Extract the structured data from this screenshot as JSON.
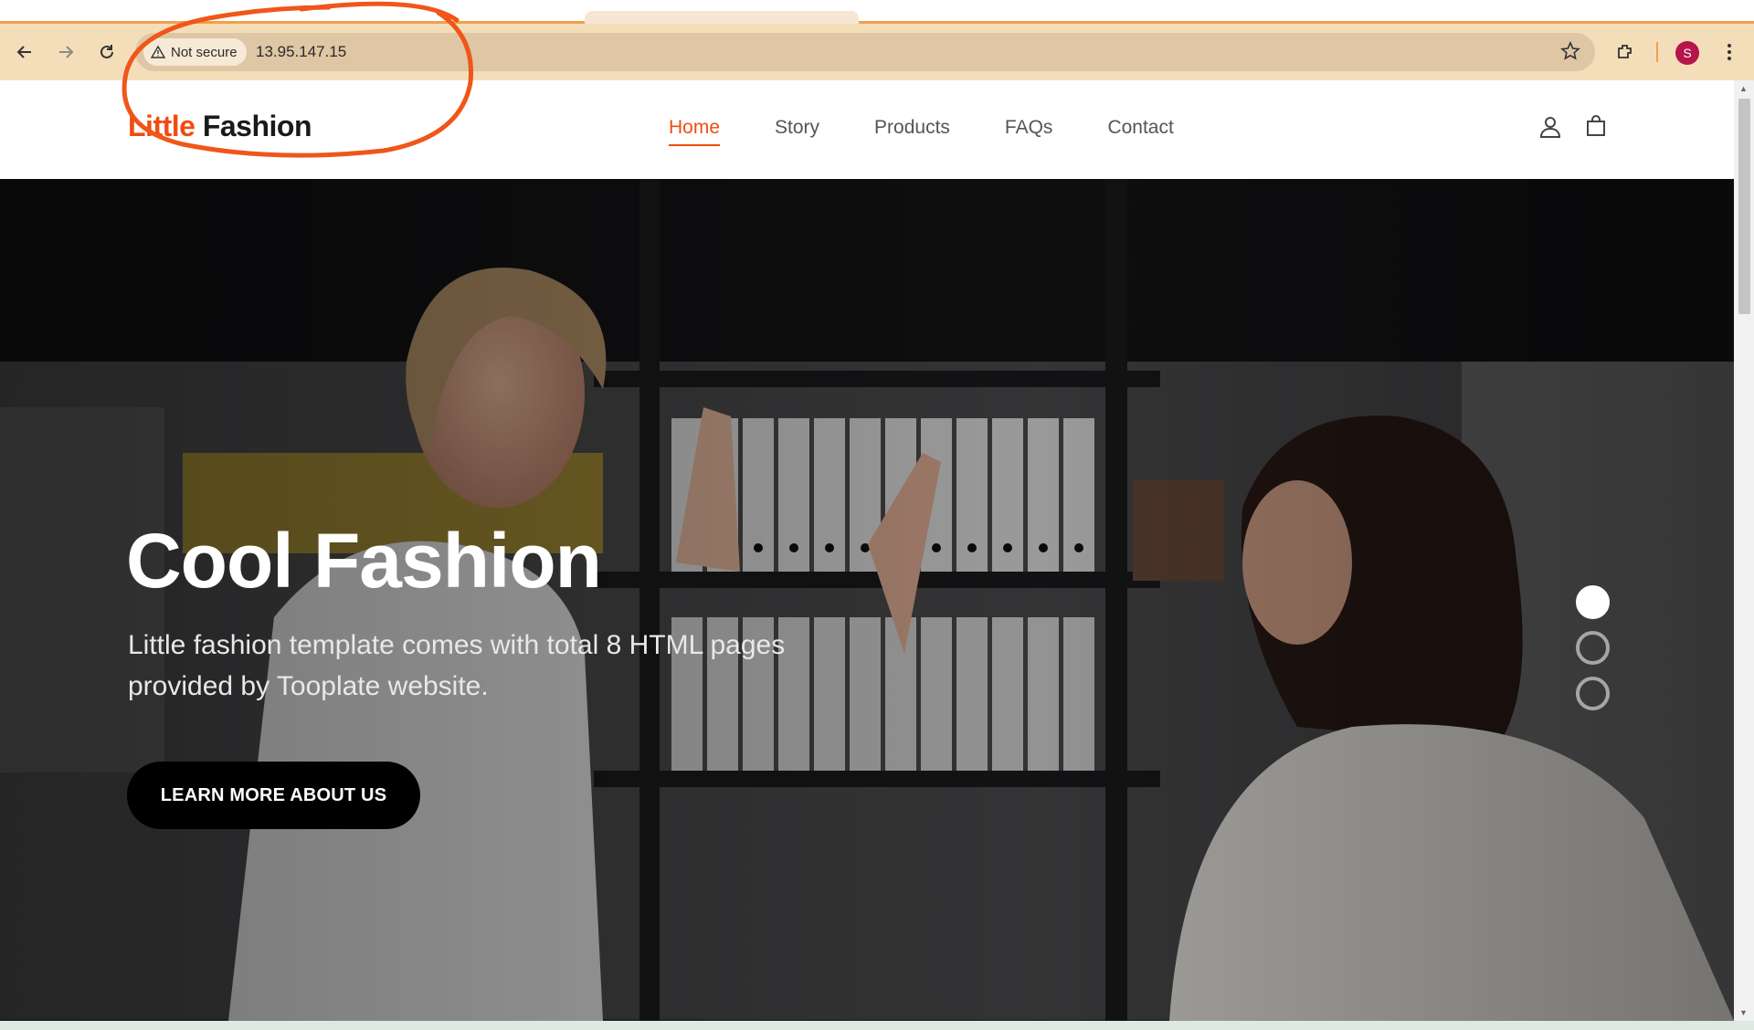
{
  "browser": {
    "security_label": "Not secure",
    "url": "13.95.147.15",
    "profile_initial": "S"
  },
  "header": {
    "brand_part1": "Little",
    "brand_part2": "Fashion",
    "nav": [
      {
        "label": "Home",
        "active": true
      },
      {
        "label": "Story",
        "active": false
      },
      {
        "label": "Products",
        "active": false
      },
      {
        "label": "FAQs",
        "active": false
      },
      {
        "label": "Contact",
        "active": false
      }
    ]
  },
  "hero": {
    "title": "Cool Fashion",
    "subtitle": "Little fashion template comes with total 8 HTML pages provided by Tooplate website.",
    "cta_label": "LEARN MORE ABOUT US",
    "slides": 3,
    "active_slide": 1
  },
  "colors": {
    "accent": "#f04c12",
    "annotation": "#f0561a",
    "toolbar": "#f4deba",
    "omnibox": "#dfc6a4"
  },
  "icons": [
    "back-icon",
    "forward-icon",
    "reload-icon",
    "warning-icon",
    "star-icon",
    "extensions-icon",
    "more-icon",
    "user-icon",
    "bag-icon"
  ]
}
